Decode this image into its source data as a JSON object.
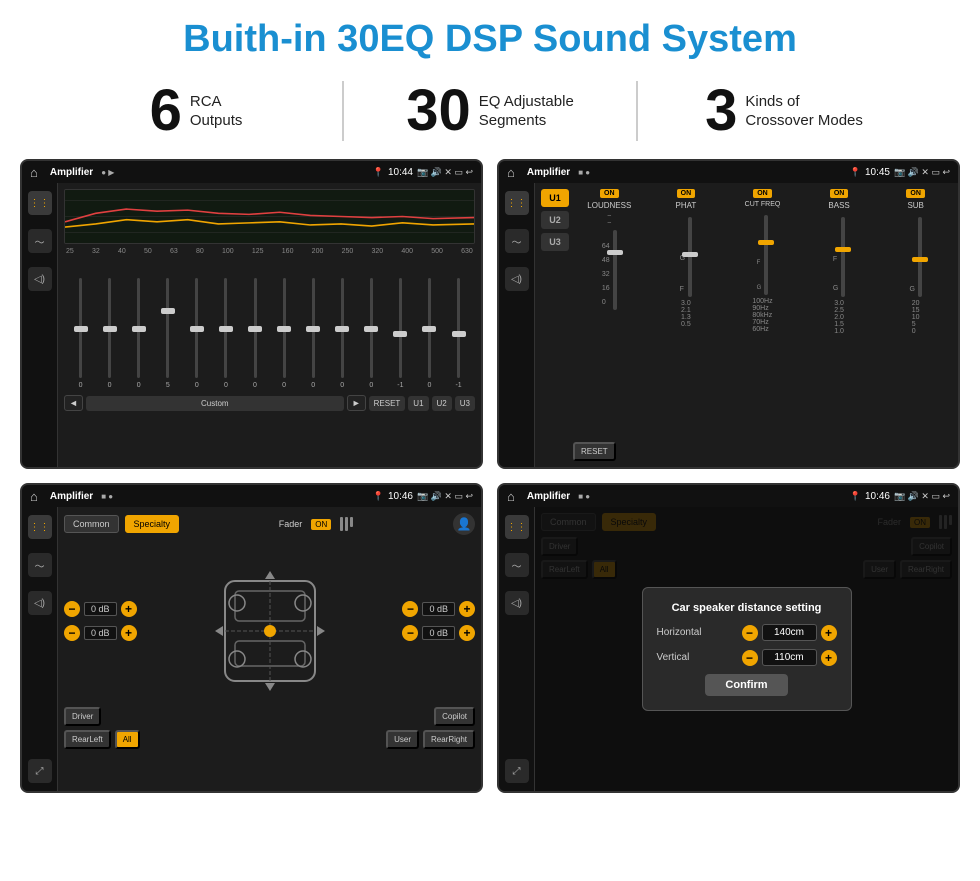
{
  "page": {
    "title": "Buith-in 30EQ DSP Sound System"
  },
  "stats": [
    {
      "number": "6",
      "label_line1": "RCA",
      "label_line2": "Outputs"
    },
    {
      "number": "30",
      "label_line1": "EQ Adjustable",
      "label_line2": "Segments"
    },
    {
      "number": "3",
      "label_line1": "Kinds of",
      "label_line2": "Crossover Modes"
    }
  ],
  "screens": [
    {
      "id": "eq-screen",
      "status_bar": {
        "app": "Amplifier",
        "time": "10:44"
      },
      "eq_freqs": [
        "25",
        "32",
        "40",
        "50",
        "63",
        "80",
        "100",
        "125",
        "160",
        "200",
        "250",
        "320",
        "400",
        "500",
        "630"
      ],
      "eq_values": [
        "0",
        "0",
        "0",
        "5",
        "0",
        "0",
        "0",
        "0",
        "0",
        "0",
        "0",
        "-1",
        "0",
        "-1"
      ],
      "preset": "Custom",
      "buttons": [
        "RESET",
        "U1",
        "U2",
        "U3"
      ]
    },
    {
      "id": "crossover-screen",
      "status_bar": {
        "app": "Amplifier",
        "time": "10:45"
      },
      "presets": [
        "U1",
        "U2",
        "U3"
      ],
      "channels": [
        "LOUDNESS",
        "PHAT",
        "CUT FREQ",
        "BASS",
        "SUB"
      ],
      "reset_label": "RESET"
    },
    {
      "id": "specialty-screen",
      "status_bar": {
        "app": "Amplifier",
        "time": "10:46"
      },
      "tabs": [
        "Common",
        "Specialty"
      ],
      "fader_label": "Fader",
      "fader_on": "ON",
      "volumes": [
        {
          "label": "",
          "value": "0 dB"
        },
        {
          "label": "",
          "value": "0 dB"
        },
        {
          "label": "",
          "value": "0 dB"
        },
        {
          "label": "",
          "value": "0 dB"
        }
      ],
      "speaker_btns": [
        "Driver",
        "Copilot",
        "RearLeft",
        "All",
        "User",
        "RearRight"
      ]
    },
    {
      "id": "dialog-screen",
      "status_bar": {
        "app": "Amplifier",
        "time": "10:46"
      },
      "tabs": [
        "Common",
        "Specialty"
      ],
      "dialog": {
        "title": "Car speaker distance setting",
        "horizontal_label": "Horizontal",
        "horizontal_value": "140cm",
        "vertical_label": "Vertical",
        "vertical_value": "110cm",
        "confirm_label": "Confirm"
      },
      "speaker_btns_visible": [
        "Driver",
        "Copilot",
        "RearLeft",
        "All",
        "User",
        "RearRight"
      ]
    }
  ],
  "colors": {
    "accent": "#f0a500",
    "title_blue": "#1a8fd1",
    "bg_dark": "#1a1a1a",
    "text_light": "#cccccc"
  }
}
